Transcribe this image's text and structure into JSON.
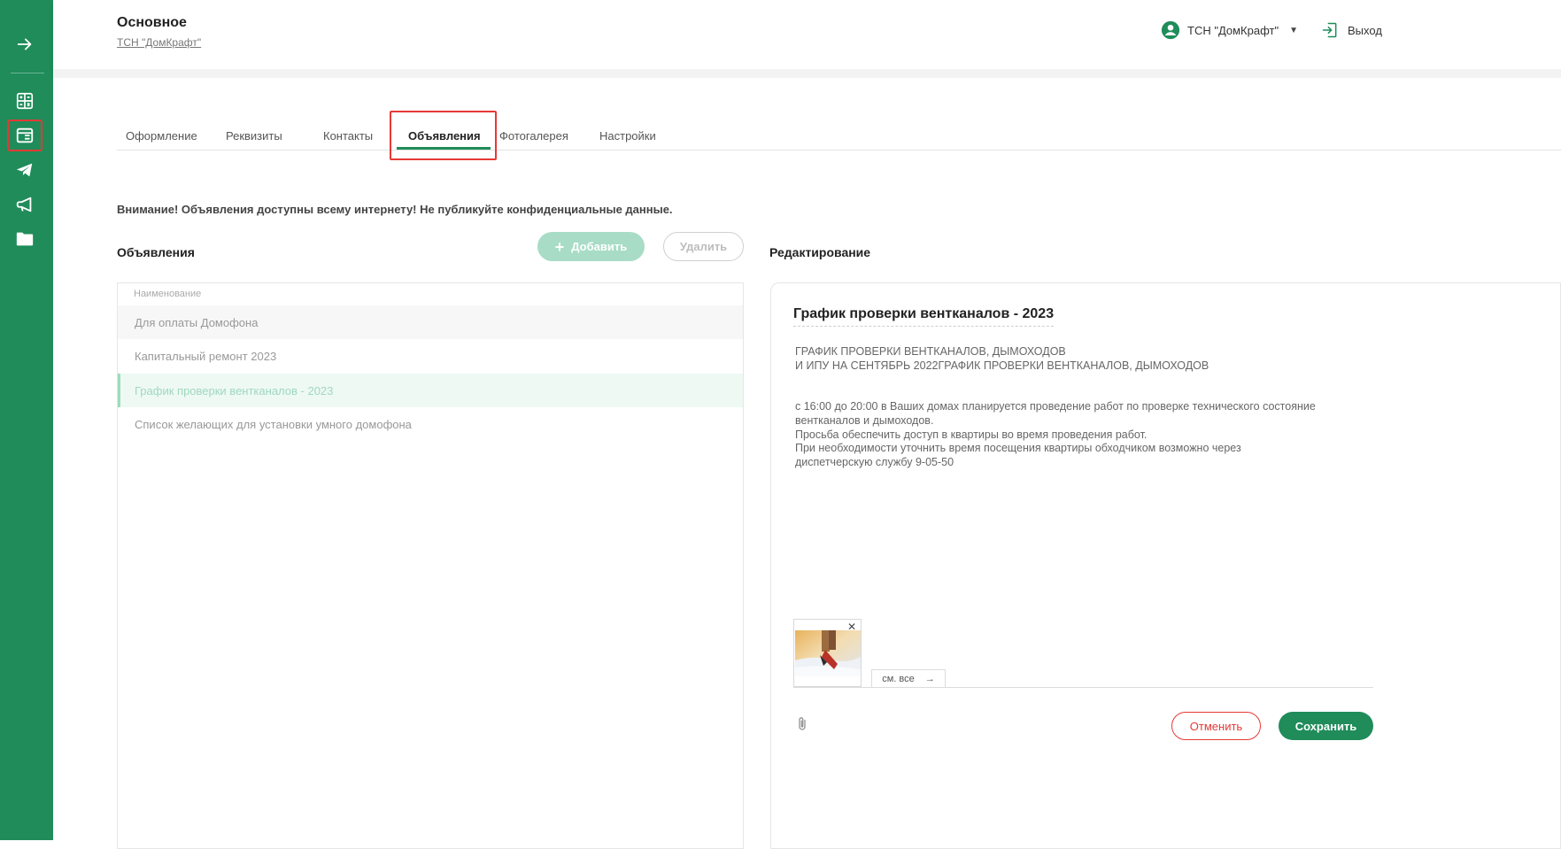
{
  "header": {
    "title": "Основное",
    "org_link": "ТСН \"ДомКрафт\"",
    "user_name": "ТСН \"ДомКрафт\"",
    "logout_label": "Выход"
  },
  "sidebar": {
    "items": [
      {
        "icon": "arrow-right-icon"
      },
      {
        "icon": "calculator-icon"
      },
      {
        "icon": "layout-icon",
        "active": true
      },
      {
        "icon": "telegram-icon"
      },
      {
        "icon": "megaphone-icon"
      },
      {
        "icon": "folder-icon"
      }
    ]
  },
  "tabs": [
    {
      "label": "Оформление"
    },
    {
      "label": "Реквизиты"
    },
    {
      "label": "Контакты"
    },
    {
      "label": "Объявления",
      "active": true
    },
    {
      "label": "Фотогалерея"
    },
    {
      "label": "Настройки"
    }
  ],
  "warning": "Внимание! Объявления доступны всему интернету! Не публикуйте конфиденциальные данные.",
  "list": {
    "title": "Объявления",
    "add_label": "Добавить",
    "delete_label": "Удалить",
    "column_header": "Наименование",
    "rows": [
      "Для оплаты Домофона",
      "Капитальный ремонт 2023",
      "График проверки вентканалов - 2023",
      "Список желающих для установки умного домофона"
    ],
    "selected_index": 2
  },
  "editor": {
    "title": "Редактирование",
    "announcement_title": "График проверки вентканалов - 2023",
    "body_lines": [
      "ГРАФИК ПРОВЕРКИ ВЕНТКАНАЛОВ, ДЫМОХОДОВ",
      "И ИПУ НА СЕНТЯБРЬ 2022ГРАФИК ПРОВЕРКИ ВЕНТКАНАЛОВ, ДЫМОХОДОВ",
      "",
      "",
      "с 16:00 до 20:00 в Ваших домах планируется проведение работ по проверке технического состояние",
      "вентканалов и дымоходов.",
      "Просьба обеспечить доступ в квартиры во время проведения работ.",
      "При необходимости уточнить время посещения квартиры обходчиком возможно через",
      "диспетчерскую службу 9-05-50"
    ],
    "see_all_label": "см. все",
    "cancel_label": "Отменить",
    "save_label": "Сохранить"
  },
  "colors": {
    "brand_green": "#1f8c5a",
    "highlight_red": "#e53935"
  }
}
